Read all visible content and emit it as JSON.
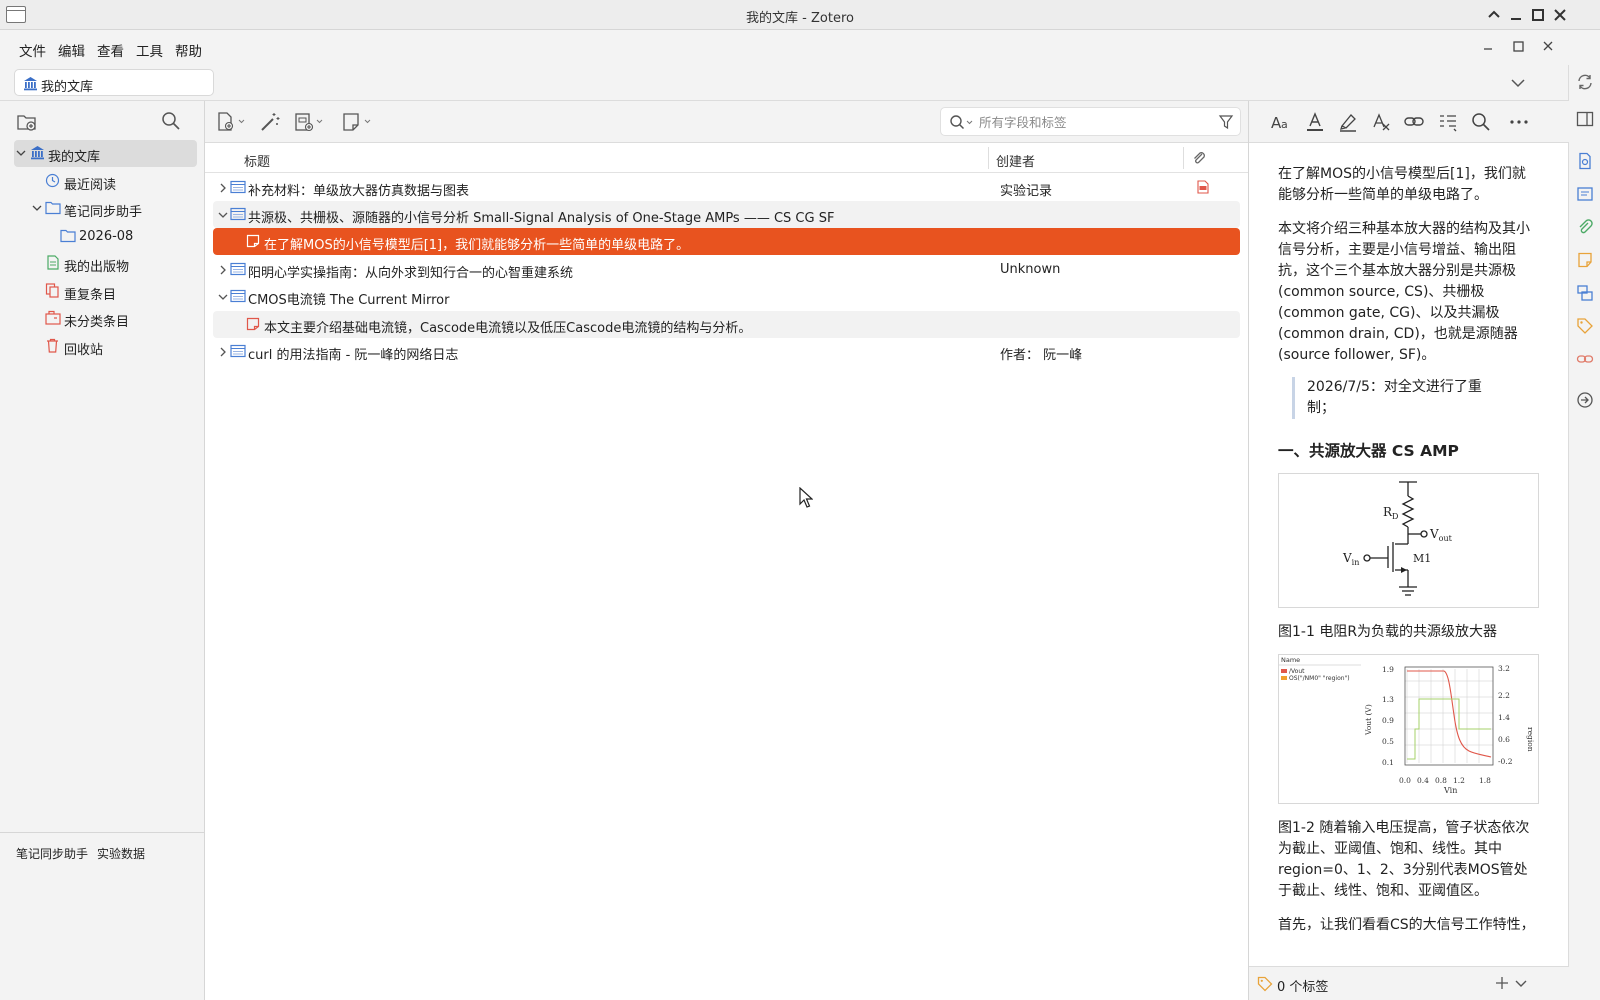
{
  "window": {
    "title": "我的文库 - Zotero"
  },
  "menubar": {
    "items": [
      "文件",
      "编辑",
      "查看",
      "工具",
      "帮助"
    ]
  },
  "tabs": [
    {
      "label": "我的文库"
    }
  ],
  "collections": {
    "items": [
      {
        "label": "我的文库",
        "icon": "library-icon",
        "selected": true
      },
      {
        "label": "最近阅读",
        "icon": "clock-icon"
      },
      {
        "label": "笔记同步助手",
        "icon": "folder-icon"
      },
      {
        "label": "2026-08",
        "icon": "folder-icon"
      },
      {
        "label": "我的出版物",
        "icon": "publications-icon"
      },
      {
        "label": "重复条目",
        "icon": "duplicates-icon"
      },
      {
        "label": "未分类条目",
        "icon": "unfiled-icon"
      },
      {
        "label": "回收站",
        "icon": "trash-icon"
      }
    ]
  },
  "tag_selector": {
    "tags": [
      "笔记同步助手",
      "实验数据"
    ]
  },
  "search": {
    "placeholder": "所有字段和标签"
  },
  "items_table": {
    "columns": {
      "title": "标题",
      "creator": "创建者"
    },
    "rows": [
      {
        "title": "补充材料：单级放大器仿真数据与图表",
        "creator": "实验记录",
        "has_pdf": true
      },
      {
        "title": "共源极、共栅极、源随器的小信号分析 Small-Signal Analysis of One-Stage AMPs —— CS CG SF",
        "creator": ""
      },
      {
        "title": "在了解MOS的小信号模型后[1]，我们就能够分析一些简单的单级电路了。",
        "creator": ""
      },
      {
        "title": "阳明心学实操指南：从向外求到知行合一的心智重建系统",
        "creator": "Unknown"
      },
      {
        "title": "CMOS电流镜 The Current Mirror",
        "creator": ""
      },
      {
        "title": "本文主要介绍基础电流镜，Cascode电流镜以及低压Cascode电流镜的结构与分析。",
        "creator": ""
      },
      {
        "title": "curl 的用法指南 - 阮一峰的网络日志",
        "creator": "作者： 阮一峰"
      }
    ]
  },
  "note": {
    "p1": "在了解MOS的小信号模型后[1]，我们就能够分析一些简单的单级电路了。",
    "p2": "本文将介绍三种基本放大器的结构及其小信号分析，主要是小信号增益、输出阻抗，这个三个基本放大器分别是共源极(common source, CS)、共栅极(common gate, CG)、以及共漏极(common drain, CD)，也就是源随器(source follower, SF)。",
    "quote": "2026/7/5：对全文进行了重制；",
    "heading": "一、共源放大器 CS AMP",
    "fig1": {
      "rd": "R",
      "rd_sub": "D",
      "vout": "V",
      "vout_sub": "out",
      "vin": "V",
      "vin_sub": "in",
      "m1": "M1"
    },
    "cap1": "图1-1 电阻R为负载的共源级放大器",
    "fig2": {
      "legend_title": "Name",
      "legend_1": "/Vout",
      "legend_2": "OS(\"/NM0\" \"region\")",
      "ylabel_left": "Vout (V)",
      "ylabel_right": "region",
      "xlabel": "Vin",
      "yticks_left": [
        "1.9",
        "1.3",
        "0.9",
        "0.5",
        "0.1"
      ],
      "yticks_right": [
        "3.2",
        "2.2",
        "1.4",
        "0.6",
        "-0.2"
      ],
      "xticks": [
        "0.0",
        "0.4",
        "0.8",
        "1.2",
        "1.8"
      ]
    },
    "cap2": "图1-2 随着输入电压提高，管子状态依次为截止、亚阈值、饱和、线性。其中region=0、1、2、3分别代表MOS管处于截止、线性、饱和、亚阈值区。",
    "p3": "首先，让我们看看CS的大信号工作特性，",
    "tag_count": "0 个标签"
  }
}
